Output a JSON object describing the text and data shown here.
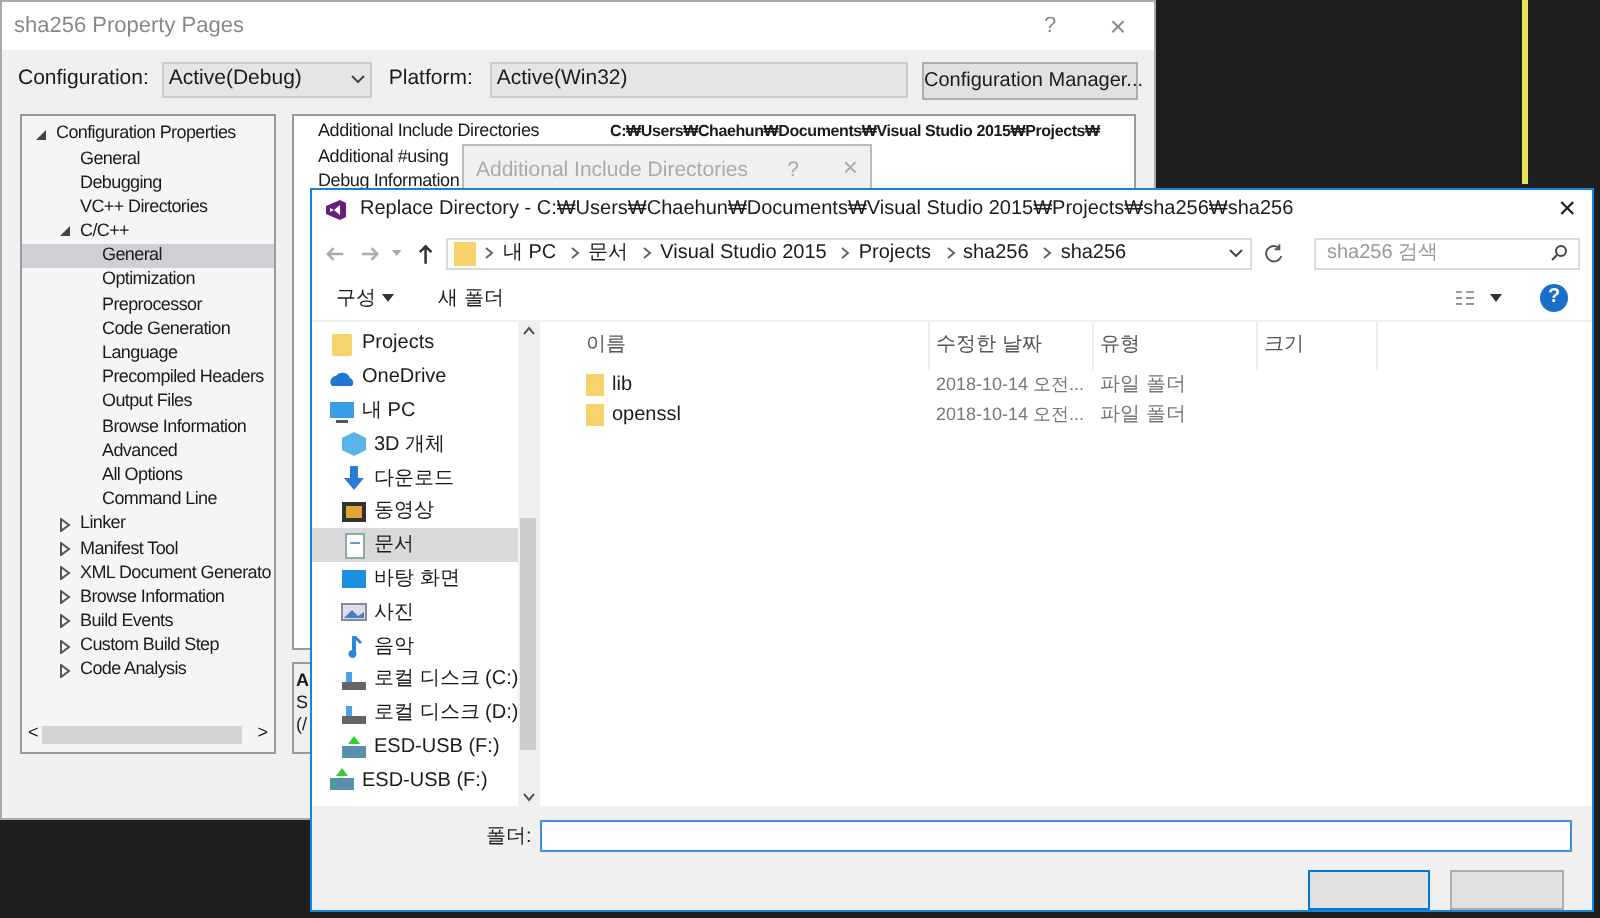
{
  "property_window": {
    "title": "sha256 Property Pages",
    "help": "?",
    "close": "×",
    "configuration": {
      "label": "Configuration:",
      "value": "Active(Debug)"
    },
    "platform": {
      "label": "Platform:",
      "value": "Active(Win32)"
    },
    "manager_button": "Configuration Manager...",
    "tree": [
      {
        "label": "Configuration Properties",
        "expanded": true,
        "selected": false,
        "children": [
          {
            "label": "General",
            "selected": false
          },
          {
            "label": "Debugging",
            "selected": false
          },
          {
            "label": "VC++ Directories",
            "selected": false
          },
          {
            "label": "C/C++",
            "expanded": true,
            "selected": false,
            "children": [
              {
                "label": "General",
                "selected": true
              },
              {
                "label": "Optimization",
                "selected": false
              },
              {
                "label": "Preprocessor",
                "selected": false
              },
              {
                "label": "Code Generation",
                "selected": false
              },
              {
                "label": "Language",
                "selected": false
              },
              {
                "label": "Precompiled Headers",
                "selected": false
              },
              {
                "label": "Output Files",
                "selected": false
              },
              {
                "label": "Browse Information",
                "selected": false
              },
              {
                "label": "Advanced",
                "selected": false
              },
              {
                "label": "All Options",
                "selected": false
              },
              {
                "label": "Command Line",
                "selected": false
              }
            ]
          },
          {
            "label": "Linker",
            "expanded": false,
            "selected": false
          },
          {
            "label": "Manifest Tool",
            "expanded": false,
            "selected": false
          },
          {
            "label": "XML Document Generato",
            "expanded": false,
            "selected": false
          },
          {
            "label": "Browse Information",
            "expanded": false,
            "selected": false
          },
          {
            "label": "Build Events",
            "expanded": false,
            "selected": false
          },
          {
            "label": "Custom Build Step",
            "expanded": false,
            "selected": false
          },
          {
            "label": "Code Analysis",
            "expanded": false,
            "selected": false
          }
        ]
      }
    ],
    "tree_scroll": {
      "left": "<",
      "right": ">"
    },
    "properties": [
      {
        "name": "Additional Include Directories",
        "value": "C:₩Users₩Chaehun₩Documents₩Visual Studio 2015₩Projects₩"
      },
      {
        "name": "Additional #using"
      },
      {
        "name": "Debug Information"
      }
    ],
    "description": {
      "title": "A",
      "lines": [
        "S",
        "(/"
      ]
    }
  },
  "include_dialog": {
    "title": "Additional Include Directories",
    "help": "?",
    "close": "×"
  },
  "replace_dialog": {
    "title": "Replace Directory - C:₩Users₩Chaehun₩Documents₩Visual Studio 2015₩Projects₩sha256₩sha256",
    "close": "×",
    "breadcrumb": [
      "내 PC",
      "문서",
      "Visual Studio 2015",
      "Projects",
      "sha256",
      "sha256"
    ],
    "search": {
      "placeholder": "sha256 검색"
    },
    "toolbar": {
      "organize": "구성",
      "new_folder": "새 폴더",
      "help": "?"
    },
    "nav_pane": [
      {
        "label": "Projects",
        "kind": "folder",
        "selected": false
      },
      {
        "label": "OneDrive",
        "kind": "cloud",
        "selected": false
      },
      {
        "label": "내 PC",
        "kind": "pc",
        "selected": false,
        "children": [
          {
            "label": "3D 개체",
            "kind": "cube",
            "selected": false
          },
          {
            "label": "다운로드",
            "kind": "download",
            "selected": false
          },
          {
            "label": "동영상",
            "kind": "film",
            "selected": false
          },
          {
            "label": "문서",
            "kind": "document",
            "selected": true
          },
          {
            "label": "바탕 화면",
            "kind": "desktop",
            "selected": false
          },
          {
            "label": "사진",
            "kind": "photo",
            "selected": false
          },
          {
            "label": "음악",
            "kind": "music",
            "selected": false
          },
          {
            "label": "로컬 디스크 (C:)",
            "kind": "drive",
            "selected": false
          },
          {
            "label": "로컬 디스크 (D:)",
            "kind": "drive",
            "selected": false
          },
          {
            "label": "ESD-USB (F:)",
            "kind": "usb",
            "selected": false
          }
        ]
      },
      {
        "label": "ESD-USB (F:)",
        "kind": "usb",
        "selected": false
      }
    ],
    "columns": [
      "이름",
      "수정한 날짜",
      "유형",
      "크기"
    ],
    "rows": [
      {
        "name": "lib",
        "date": "2018-10-14 오전...",
        "type": "파일 폴더"
      },
      {
        "name": "openssl",
        "date": "2018-10-14 오전...",
        "type": "파일 폴더"
      }
    ],
    "folder_label": "폴더:"
  }
}
